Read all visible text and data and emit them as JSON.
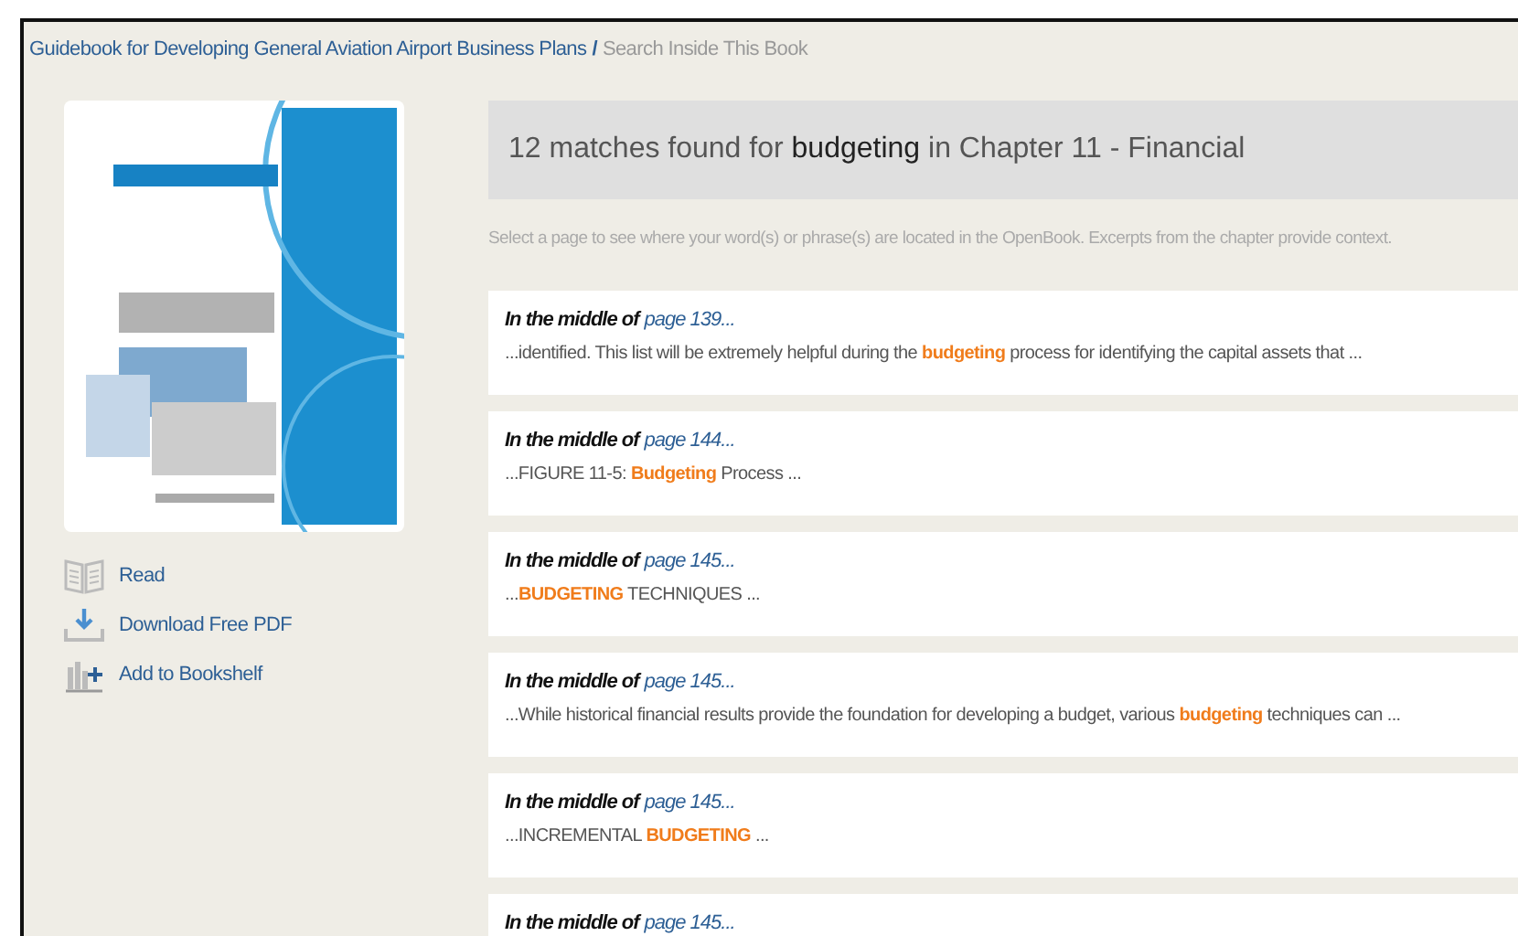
{
  "breadcrumb": {
    "book_link": "Guidebook for Developing General Aviation Airport Business Plans",
    "separator": "/",
    "current": "Search Inside This Book"
  },
  "actions": [
    {
      "kind": "read",
      "label": "Read"
    },
    {
      "kind": "download",
      "label": "Download Free PDF"
    },
    {
      "kind": "bookshelf",
      "label": "Add to Bookshelf"
    }
  ],
  "results_header": {
    "count_text": "12 matches found for",
    "term": "budgeting",
    "chapter_text": "in Chapter 11 - Financial"
  },
  "help_text": "Select a page to see where your word(s) or phrase(s) are located in the OpenBook. Excerpts from the chapter provide context.",
  "matches": [
    {
      "prefix": "In the middle of",
      "page_link": "page 139...",
      "before": "...identified. This list will be extremely helpful during the",
      "match": "budgeting",
      "after": "process for identifying the capital assets that ..."
    },
    {
      "prefix": "In the middle of",
      "page_link": "page 144...",
      "before": "...FIGURE 11-5:",
      "match": "Budgeting",
      "after": "Process ..."
    },
    {
      "prefix": "In the middle of",
      "page_link": "page 145...",
      "before": "...",
      "match": "BUDGETING",
      "after": "TECHNIQUES ..."
    },
    {
      "prefix": "In the middle of",
      "page_link": "page 145...",
      "before": "...While historical financial results provide the foundation for developing a budget, various",
      "match": "budgeting",
      "after": "techniques can ..."
    },
    {
      "prefix": "In the middle of",
      "page_link": "page 145...",
      "before": "...INCREMENTAL",
      "match": "BUDGETING",
      "after": "..."
    },
    {
      "prefix": "In the middle of",
      "page_link": "page 145..."
    }
  ]
}
